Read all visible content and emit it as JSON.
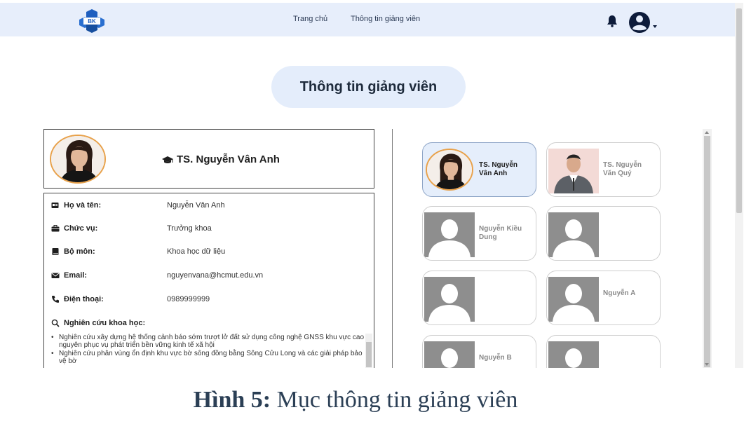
{
  "navbar": {
    "logo_text": "BK",
    "links": [
      {
        "label": "Trang chủ"
      },
      {
        "label": "Thông tin giảng viên"
      }
    ],
    "colors": {
      "background": "#e7eefb",
      "logo": "#1f5fbf"
    }
  },
  "page_title": "Thông tin giảng viên",
  "profile": {
    "name": "TS. Nguyễn Vân Anh",
    "fields": [
      {
        "icon": "id-card-icon",
        "label": "Họ và tên:",
        "value": "Nguyễn Vân Anh"
      },
      {
        "icon": "briefcase-icon",
        "label": "Chức vụ:",
        "value": "Trưởng khoa"
      },
      {
        "icon": "book-icon",
        "label": "Bộ môn:",
        "value": "Khoa học dữ liệu"
      },
      {
        "icon": "envelope-icon",
        "label": "Email:",
        "value": "nguyenvana@hcmut.edu.vn"
      },
      {
        "icon": "phone-icon",
        "label": "Điện thoại:",
        "value": "0989999999"
      }
    ],
    "research_label": "Nghiên cứu khoa học:",
    "research_items": [
      "Nghiên cứu xây dựng hệ thống cảnh báo sớm trượt lở đất sử dụng công nghệ GNSS khu vực cao nguyên phục vụ phát triển bền vững kinh tế xã hội",
      "Nghiên cứu phân vùng ổn định khu vực bờ sông đồng bằng Sông Cửu Long và các giải pháp bảo vệ bờ"
    ]
  },
  "lecturers": [
    {
      "name": "TS. Nguyễn Vân Anh",
      "photo": "woman-photo",
      "active": true
    },
    {
      "name": "TS. Nguyễn Văn Quý",
      "photo": "man-photo",
      "active": false
    },
    {
      "name": "Nguyễn Kiều Dung",
      "photo": "placeholder-avatar",
      "active": false
    },
    {
      "name": "",
      "photo": "placeholder-avatar",
      "active": false
    },
    {
      "name": "",
      "photo": "placeholder-avatar",
      "active": false
    },
    {
      "name": "Nguyễn A",
      "photo": "placeholder-avatar",
      "active": false
    },
    {
      "name": "Nguyễn B",
      "photo": "placeholder-avatar",
      "active": false
    },
    {
      "name": "",
      "photo": "placeholder-avatar",
      "active": false
    }
  ],
  "caption": {
    "prefix": "Hình 5:",
    "text": " Mục thông tin giảng viên"
  }
}
